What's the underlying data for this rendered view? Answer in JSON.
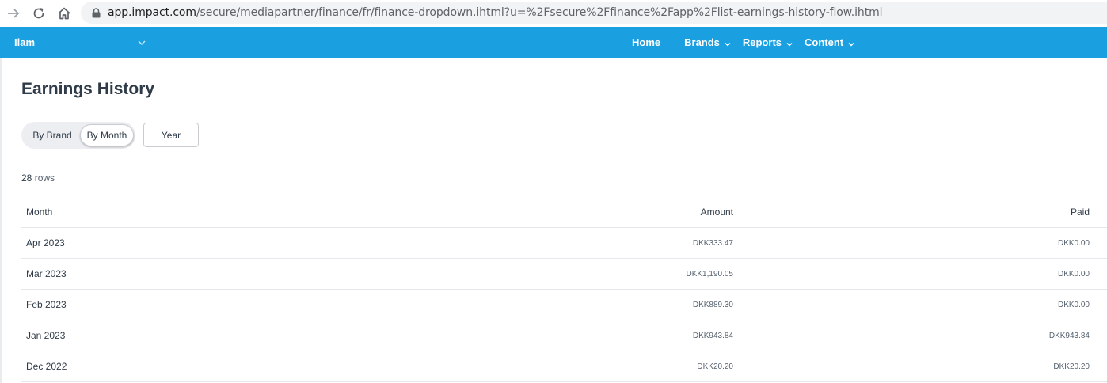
{
  "browser": {
    "url_host": "app.impact.com",
    "url_path": "/secure/mediapartner/finance/fr/finance-dropdown.ihtml?u=%2Fsecure%2Ffinance%2Fapp%2Flist-earnings-history-flow.ihtml"
  },
  "header": {
    "account_name": "Ilam",
    "nav": [
      {
        "label": "Home",
        "has_dropdown": false
      },
      {
        "label": "Brands",
        "has_dropdown": true
      },
      {
        "label": "Reports",
        "has_dropdown": true
      },
      {
        "label": "Content",
        "has_dropdown": true
      }
    ],
    "color": "#1a9fe0"
  },
  "page": {
    "title": "Earnings History",
    "toggle": {
      "by_brand": "By Brand",
      "by_month": "By Month",
      "selected": "By Month"
    },
    "year_button": "Year",
    "row_count": "28",
    "row_count_suffix": "rows"
  },
  "table": {
    "columns": [
      "Month",
      "Amount",
      "Paid"
    ],
    "rows": [
      {
        "month": "Apr 2023",
        "amount": "DKK333.47",
        "paid": "DKK0.00"
      },
      {
        "month": "Mar 2023",
        "amount": "DKK1,190.05",
        "paid": "DKK0.00"
      },
      {
        "month": "Feb 2023",
        "amount": "DKK889.30",
        "paid": "DKK0.00"
      },
      {
        "month": "Jan 2023",
        "amount": "DKK943.84",
        "paid": "DKK943.84"
      },
      {
        "month": "Dec 2022",
        "amount": "DKK20.20",
        "paid": "DKK20.20"
      }
    ]
  }
}
